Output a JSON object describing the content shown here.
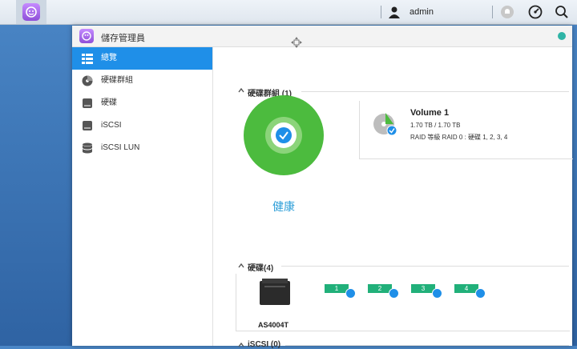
{
  "taskbar": {
    "user_name": "admin",
    "icons": [
      "app-launcher-icon",
      "user-icon",
      "notification-icon",
      "performance-icon",
      "search-icon"
    ]
  },
  "window": {
    "title": "儲存管理員",
    "sidebar": {
      "items": [
        {
          "label": "總覽",
          "icon": "overview-icon",
          "active": true
        },
        {
          "label": "硬碟群組",
          "icon": "volume-group-icon",
          "active": false
        },
        {
          "label": "硬碟",
          "icon": "disk-icon",
          "active": false
        },
        {
          "label": "iSCSI",
          "icon": "iscsi-icon",
          "active": false
        },
        {
          "label": "iSCSI LUN",
          "icon": "iscsi-lun-icon",
          "active": false
        }
      ]
    },
    "volume_section": {
      "heading": "硬碟群組 (1)",
      "health_label": "健康",
      "health_color": "#4cbb3e",
      "volume": {
        "name": "Volume 1",
        "capacity": "1.70 TB / 1.70 TB",
        "raid_info": "RAID 等級 RAID 0 : 硬碟 1, 2, 3, 4"
      }
    },
    "disk_section": {
      "heading": "硬碟(4)",
      "device_name": "AS4004T",
      "disks": [
        "1",
        "2",
        "3",
        "4"
      ],
      "disk_color": "#21b07a"
    },
    "iscsi_section": {
      "heading": "iSCSI (0)"
    }
  }
}
